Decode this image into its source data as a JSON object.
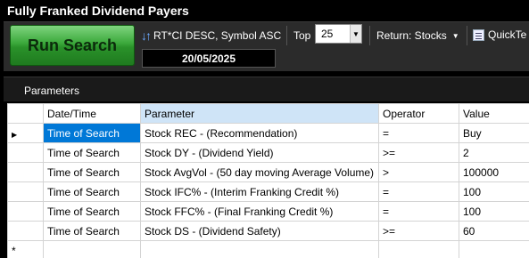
{
  "window": {
    "title": "Fully Franked Dividend Payers"
  },
  "toolbar": {
    "run_label": "Run Search",
    "sort_label": "RT*CI DESC, Symbol ASC",
    "date_value": "20/05/2025",
    "top_label": "Top",
    "top_value": "25",
    "return_label": "Return: Stocks",
    "quick_label": "QuickTe"
  },
  "panel": {
    "title": "Parameters"
  },
  "table": {
    "headers": [
      "Date/Time",
      "Parameter",
      "Operator",
      "Value"
    ],
    "rows": [
      {
        "time": "Time of Search",
        "param": "Stock REC - (Recommendation)",
        "op": "=",
        "value": "Buy"
      },
      {
        "time": "Time of Search",
        "param": "Stock DY - (Dividend Yield)",
        "op": ">=",
        "value": "2"
      },
      {
        "time": "Time of Search",
        "param": "Stock AvgVol - (50 day moving Average Volume)",
        "op": ">",
        "value": "100000"
      },
      {
        "time": "Time of Search",
        "param": "Stock IFC% - (Interim Franking Credit %)",
        "op": "=",
        "value": "100"
      },
      {
        "time": "Time of Search",
        "param": "Stock FFC% - (Final Franking Credit %)",
        "op": "=",
        "value": "100"
      },
      {
        "time": "Time of Search",
        "param": "Stock DS - (Dividend Safety)",
        "op": ">=",
        "value": "60"
      }
    ],
    "new_row_marker": "*"
  },
  "icons": {
    "sort": "sort-arrows-icon",
    "quick": "quick-test-icon",
    "current_row": "current-row-arrow-icon"
  },
  "colors": {
    "run_button": "#3aa83a",
    "selected_cell": "#0078d7",
    "selected_header": "#cfe4f7"
  }
}
